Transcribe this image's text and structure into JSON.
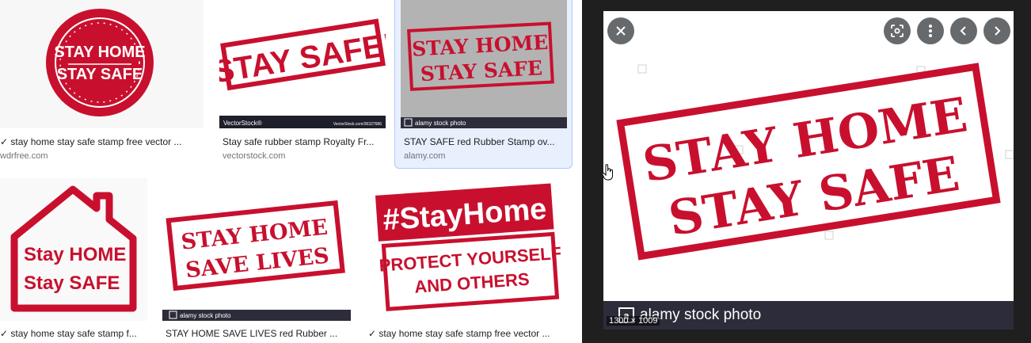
{
  "results": [
    {
      "title": "✓ stay home stay safe stamp free vector ...",
      "source": "wdrfree.com",
      "art": [
        "STAY HOME",
        "STAY SAFE"
      ]
    },
    {
      "title": "Stay safe rubber stamp Royalty Fr...",
      "source": "vectorstock.com",
      "art": [
        "STAY SAFE!"
      ],
      "footer_left": "VectorStock®",
      "footer_right": "VectorStock.com/36327686"
    },
    {
      "title": "STAY SAFE red Rubber Stamp ov...",
      "source": "alamy.com",
      "art": [
        "STAY HOME",
        "STAY SAFE"
      ],
      "footer": "alamy stock photo"
    },
    {
      "title": "✓ stay home stay safe stamp f...",
      "art": [
        "Stay HOME",
        "Stay SAFE"
      ]
    },
    {
      "title": "STAY HOME SAVE LIVES red Rubber ...",
      "art": [
        "STAY HOME",
        "SAVE LIVES"
      ],
      "footer": "alamy stock photo"
    },
    {
      "title": "✓ stay home stay safe stamp free vector ...",
      "art": [
        "#StayHome",
        "PROTECT YOURSELF",
        "AND OTHERS"
      ]
    }
  ],
  "viewer": {
    "art": [
      "STAY HOME",
      "STAY SAFE"
    ],
    "watermark": "alamy stock photo",
    "dimensions": "1300 × 1009",
    "buttons": {
      "close": "close-icon",
      "lens": "lens-icon",
      "more": "more-vert-icon",
      "prev": "chevron-left-icon",
      "next": "chevron-right-icon"
    }
  },
  "colors": {
    "stamp_red": "#c8102e",
    "viewer_bg": "#1f1f1f",
    "selected_bg": "#e8f0fe"
  }
}
